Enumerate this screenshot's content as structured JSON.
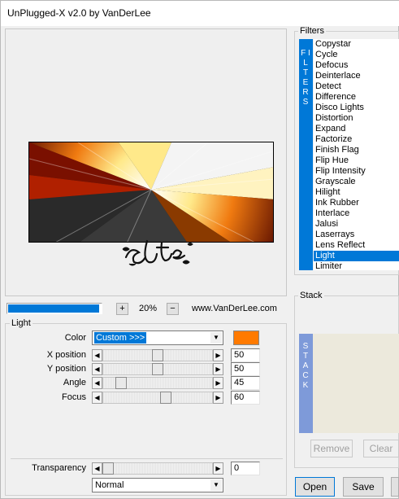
{
  "window": {
    "title": "UnPlugged-X v2.0 by VanDerLee"
  },
  "preview": {
    "zoom": "20%",
    "zoom_minus": "−",
    "zoom_plus": "+",
    "website": "www.VanDerLee.com",
    "zoom_progress": 0.6
  },
  "light": {
    "group_label": "Light",
    "color_label": "Color",
    "color_value": "Custom >>>",
    "color_swatch": "#ff7a00",
    "params": [
      {
        "label": "X position",
        "value": "50",
        "level": 0.5
      },
      {
        "label": "Y position",
        "value": "50",
        "level": 0.5
      },
      {
        "label": "Angle",
        "value": "45",
        "level": 0.13
      },
      {
        "label": "Focus",
        "value": "60",
        "level": 0.58
      }
    ],
    "transparency_label": "Transparency",
    "transparency_value": "0",
    "transparency_level": 0.0,
    "blend_mode": "Normal"
  },
  "filters": {
    "group_label": "Filters",
    "side_label": "F I L T E R S",
    "items": [
      "Copystar",
      "Cycle",
      "Defocus",
      "Deinterlace",
      "Detect",
      "Difference",
      "Disco Lights",
      "Distortion",
      "Expand",
      "Factorize",
      "Finish Flag",
      "Flip Hue",
      "Flip Intensity",
      "Grayscale",
      "Hilight",
      "Ink Rubber",
      "Interlace",
      "Jalusi",
      "Laserrays",
      "Lens Reflect",
      "Light",
      "Limiter"
    ],
    "selected": "Light"
  },
  "stack": {
    "group_label": "Stack",
    "side_label": "S T A C K",
    "remove_label": "Remove",
    "clear_label": "Clear"
  },
  "buttons": {
    "open_label": "Open",
    "save_label": "Save"
  },
  "watermark": {
    "signature": "Estela"
  }
}
